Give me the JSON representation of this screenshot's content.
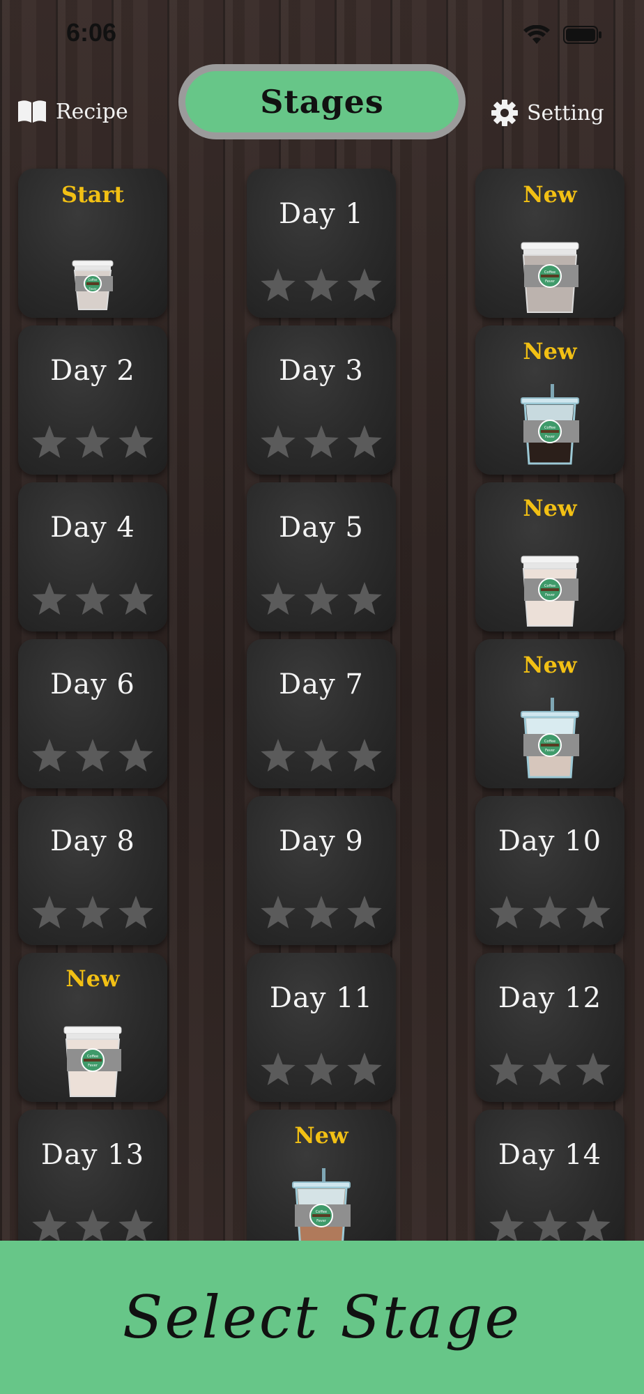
{
  "status": {
    "time": "6:06"
  },
  "header": {
    "title": "Stages",
    "recipe_label": "Recipe",
    "setting_label": "Setting"
  },
  "stages": [
    {
      "badge": "Start",
      "cup": "hot-small"
    },
    {
      "title": "Day 1",
      "stars": 0,
      "max_stars": 3
    },
    {
      "badge": "New",
      "cup": "hot-dark"
    },
    {
      "title": "Day 2",
      "stars": 0,
      "max_stars": 3
    },
    {
      "title": "Day 3",
      "stars": 0,
      "max_stars": 3
    },
    {
      "badge": "New",
      "cup": "iced-dark"
    },
    {
      "title": "Day 4",
      "stars": 0,
      "max_stars": 3
    },
    {
      "title": "Day 5",
      "stars": 0,
      "max_stars": 3
    },
    {
      "badge": "New",
      "cup": "hot-latte"
    },
    {
      "title": "Day 6",
      "stars": 0,
      "max_stars": 3
    },
    {
      "title": "Day 7",
      "stars": 0,
      "max_stars": 3
    },
    {
      "badge": "New",
      "cup": "iced-latte"
    },
    {
      "title": "Day 8",
      "stars": 0,
      "max_stars": 3
    },
    {
      "title": "Day 9",
      "stars": 0,
      "max_stars": 3
    },
    {
      "title": "Day 10",
      "stars": 0,
      "max_stars": 3
    },
    {
      "badge": "New",
      "cup": "hot-latte"
    },
    {
      "title": "Day 11",
      "stars": 0,
      "max_stars": 3
    },
    {
      "title": "Day 12",
      "stars": 0,
      "max_stars": 3
    },
    {
      "title": "Day 13",
      "stars": 0,
      "max_stars": 3
    },
    {
      "badge": "New",
      "cup": "iced-caramel"
    },
    {
      "title": "Day 14",
      "stars": 0,
      "max_stars": 3
    }
  ],
  "cup_logo_text": [
    "Coffee",
    "Fever"
  ],
  "footer": {
    "label": "Select Stage"
  },
  "colors": {
    "accent_green": "#67c688",
    "badge_yellow": "#f2c014",
    "star_gray": "#5b5b5b"
  }
}
